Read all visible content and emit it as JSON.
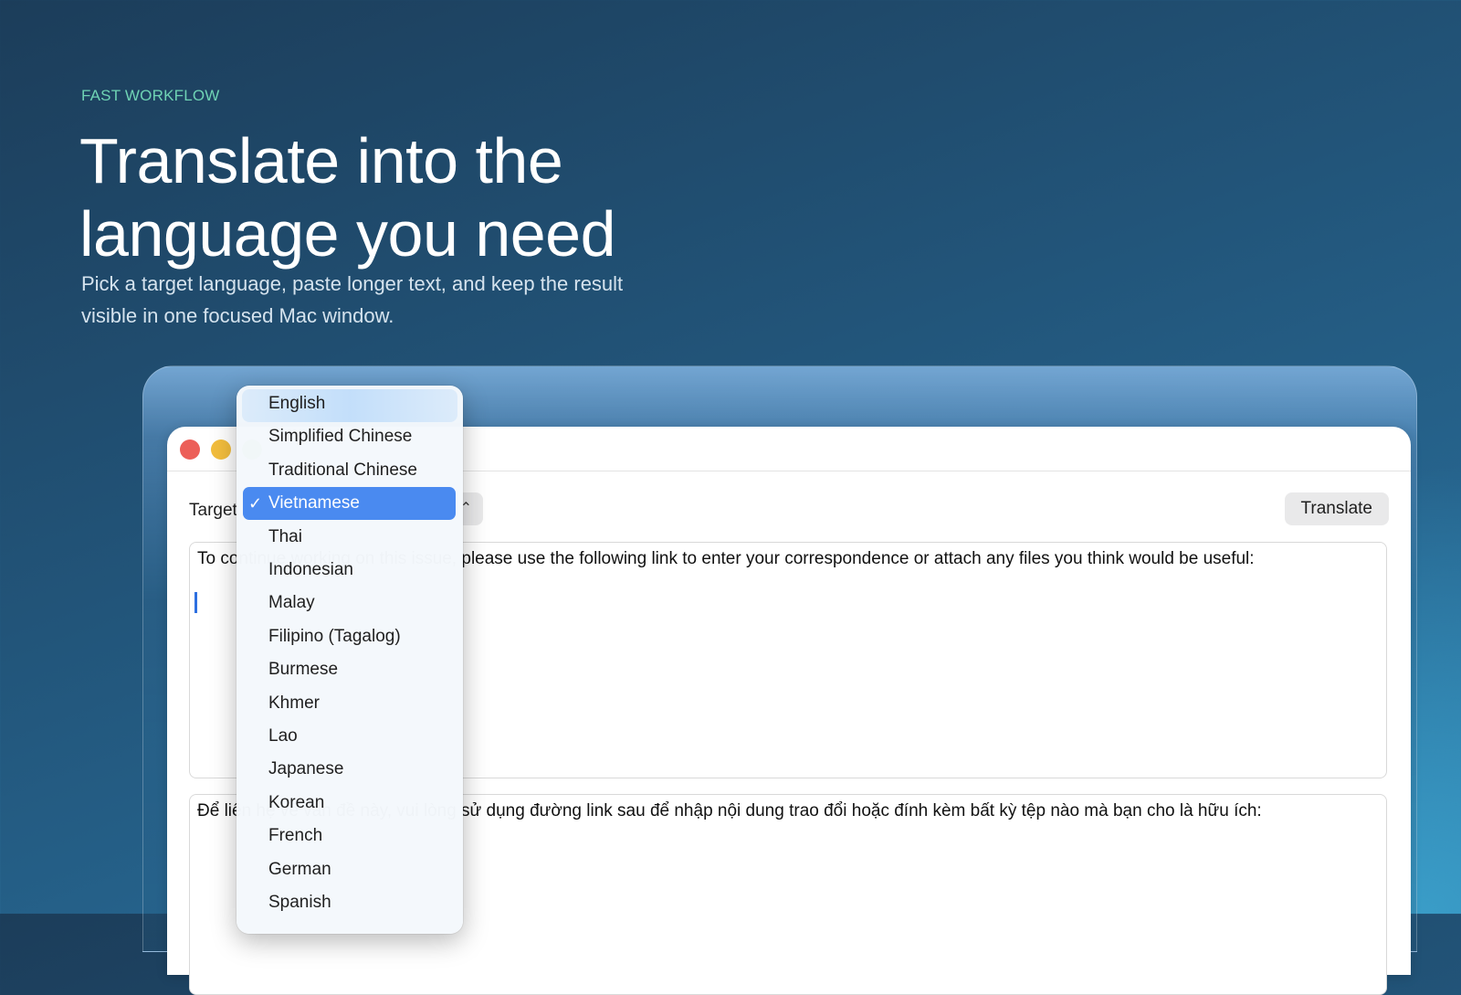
{
  "hero": {
    "eyebrow": "FAST WORKFLOW",
    "headline": "Translate into the language you need",
    "subtitle": "Pick a target language, paste longer text, and keep the result visible in one focused Mac window."
  },
  "app": {
    "target_label": "Target",
    "selected_language": "Vietnamese",
    "translate_label": "Translate",
    "source_text": "To continue working on this issue, please use the following link to enter your correspondence or attach any files you think would be useful:",
    "output_text": "Để liên hệ về vấn đề này, vui lòng sử dụng đường link sau để nhập nội dung trao đổi hoặc đính kèm bất kỳ tệp nào mà bạn cho là hữu ích:"
  },
  "dropdown": {
    "check": "✓",
    "items": [
      "English",
      "Simplified Chinese",
      "Traditional Chinese",
      "Vietnamese",
      "Thai",
      "Indonesian",
      "Malay",
      "Filipino (Tagalog)",
      "Burmese",
      "Khmer",
      "Lao",
      "Japanese",
      "Korean",
      "French",
      "German",
      "Spanish"
    ],
    "selected_index": 3
  },
  "colors": {
    "accent": "#4a8af0",
    "eyebrow": "#6fd3b4",
    "close": "#ec5f58",
    "minimize": "#f2bd3d",
    "maximize": "#5fc455"
  }
}
